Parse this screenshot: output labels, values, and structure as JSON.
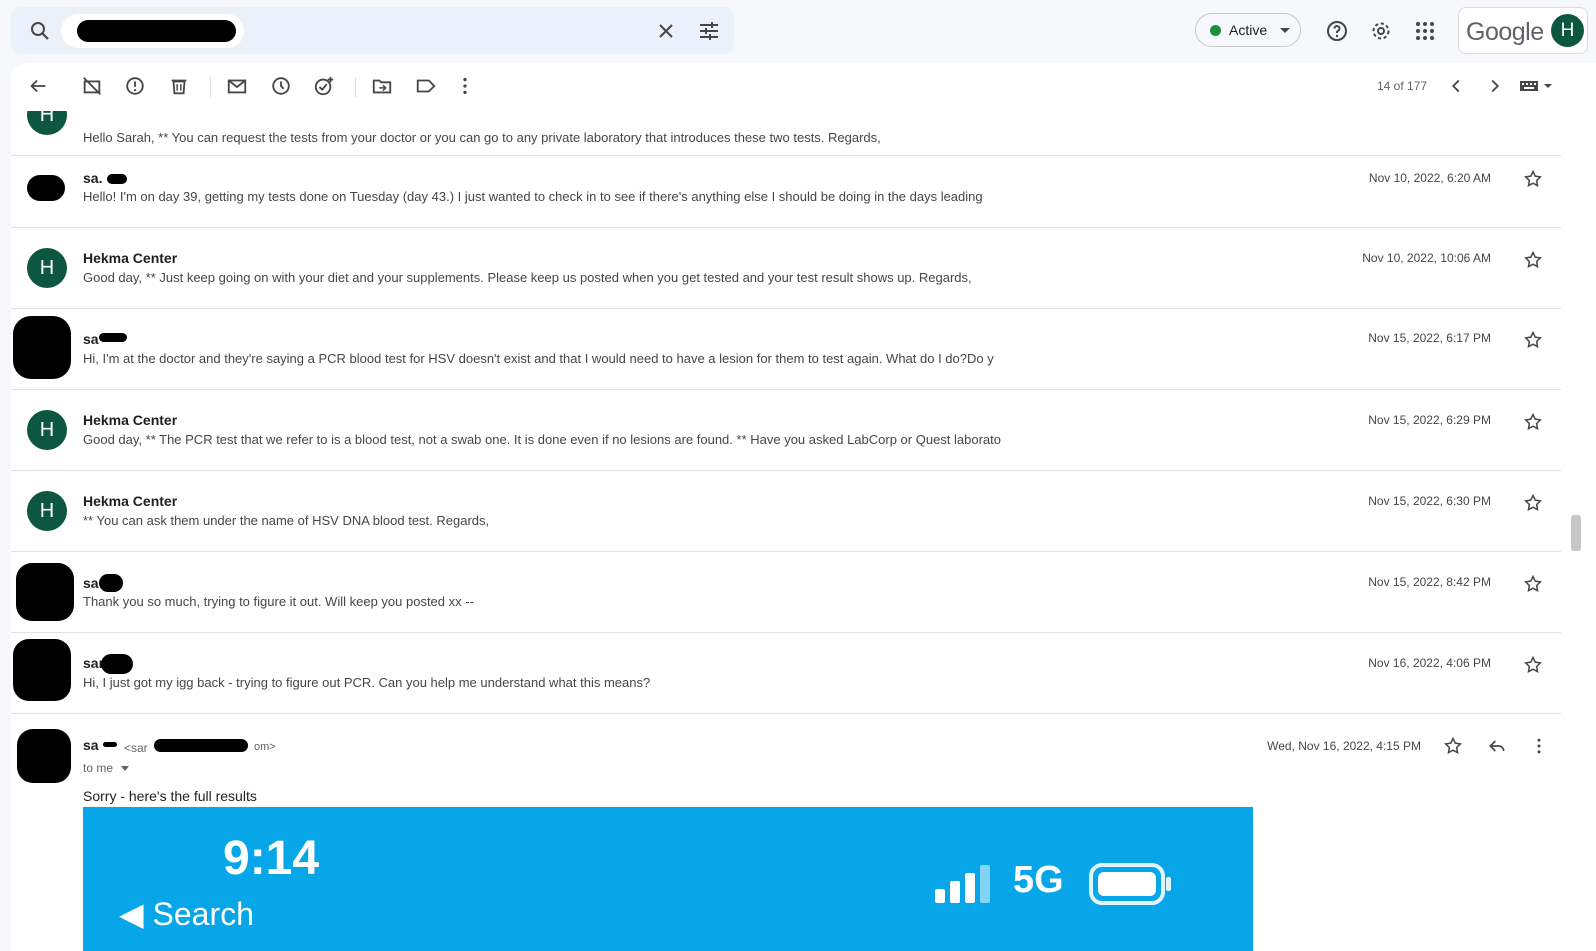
{
  "search": {
    "query": "",
    "clear_icon": "close-icon",
    "filter_icon": "tune-icon"
  },
  "status": {
    "label": "Active",
    "color": "#1e8e3e"
  },
  "account": {
    "brand": "Google",
    "initial": "H"
  },
  "toolbar": {
    "pager": "14 of 177"
  },
  "messages": [
    {
      "sender": "",
      "initial": "H",
      "date": "",
      "snippet": "Hello Sarah, ** You can request the tests from your doctor or you can go to any private laboratory that introduces these two tests. Regards,"
    },
    {
      "sender": "sa.",
      "initial": "",
      "date": "Nov 10, 2022, 6:20 AM",
      "snippet": "Hello! I'm on day 39, getting my tests done on Tuesday (day 43.) I just wanted to check in to see if there's anything else I should be doing in the days leading"
    },
    {
      "sender": "Hekma Center",
      "initial": "H",
      "date": "Nov 10, 2022, 10:06 AM",
      "snippet": "Good day, ** Just keep going on with your diet and your supplements. Please keep us posted when you get tested and your test result shows up. Regards,"
    },
    {
      "sender": "sa",
      "initial": "",
      "date": "Nov 15, 2022, 6:17 PM",
      "snippet": "Hi, I'm at the doctor and they're saying a PCR blood test for HSV doesn't exist and that I would need to have a lesion for them to test again. What do I do?Do y"
    },
    {
      "sender": "Hekma Center",
      "initial": "H",
      "date": "Nov 15, 2022, 6:29 PM",
      "snippet": "Good day, ** The PCR test that we refer to is a blood test, not a swab one. It is done even if no lesions are found. ** Have you asked LabCorp or Quest laborato"
    },
    {
      "sender": "Hekma Center",
      "initial": "H",
      "date": "Nov 15, 2022, 6:30 PM",
      "snippet": "** You can ask them under the name of HSV DNA blood test. Regards,"
    },
    {
      "sender": "sa",
      "initial": "",
      "date": "Nov 15, 2022, 8:42 PM",
      "snippet": "Thank you so much, trying to figure it out. Will keep you posted xx --"
    },
    {
      "sender": "sar",
      "initial": "",
      "date": "Nov 16, 2022, 4:06 PM",
      "snippet": "Hi, I just got my igg back - trying to figure out PCR. Can you help me understand what this means?"
    }
  ],
  "open_message": {
    "sender": "sa",
    "email_prefix": "<sar",
    "email_suffix": "om>",
    "date": "Wed, Nov 16, 2022, 4:15 PM",
    "to": "to me",
    "body": "Sorry - here's the full results",
    "attachment": {
      "time": "9:14",
      "back_label": "◀ Search",
      "network": "5G"
    }
  }
}
